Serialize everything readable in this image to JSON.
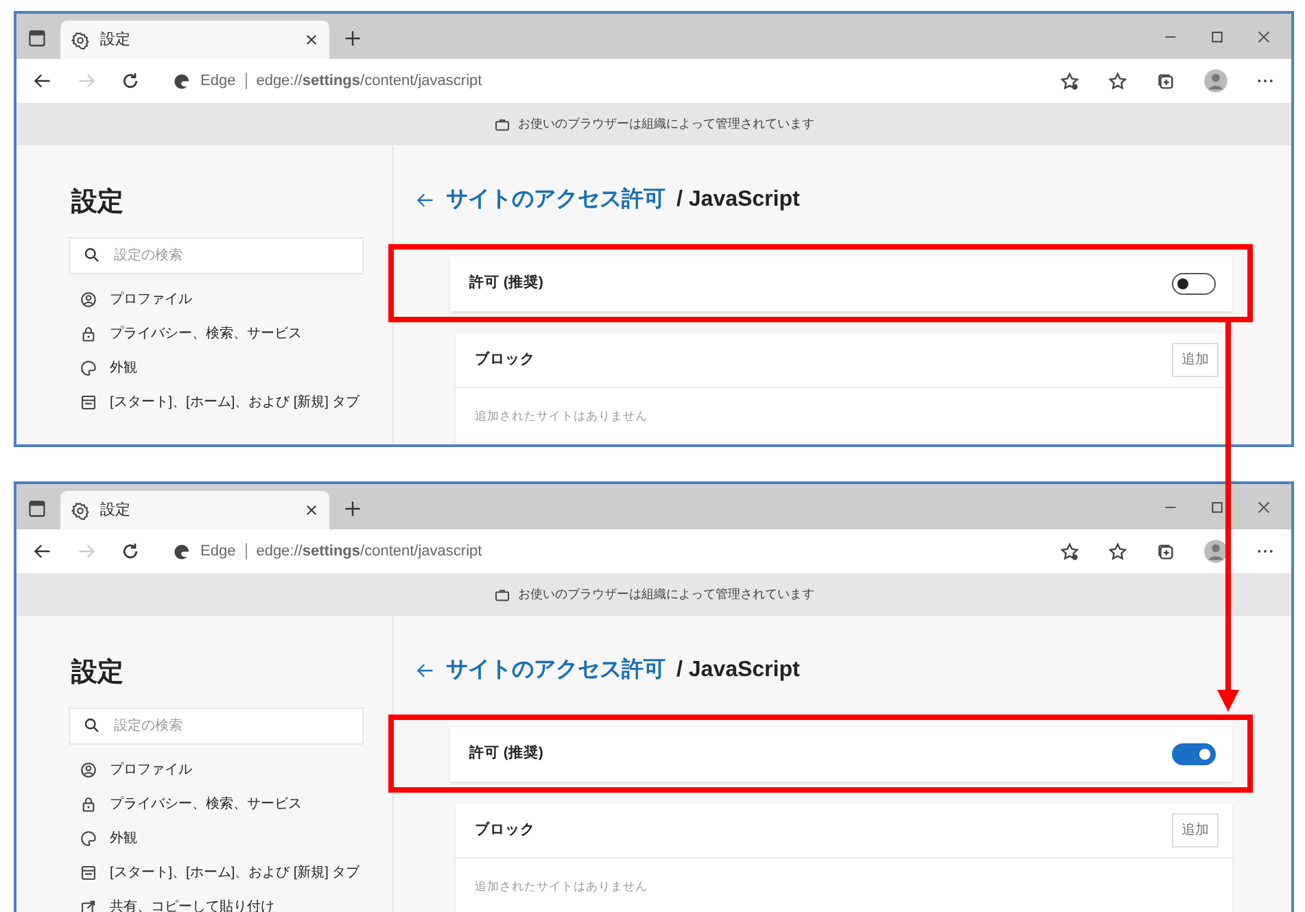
{
  "screenshots": [
    {
      "tab": {
        "title": "設定"
      },
      "address": {
        "site": "Edge",
        "url": "edge://**settings**/content/javascript"
      },
      "infobar": {
        "text": "お使いのブラウザーは組織によって管理されています"
      },
      "sidebar": {
        "title": "設定",
        "search": {
          "placeholder": "設定の検索"
        },
        "items": [
          "プロファイル",
          "プライバシー、検索、サービス",
          "外観",
          "[スタート]、[ホーム]、および [新規] タブ"
        ]
      },
      "breadcrumb": {
        "link": "サイトのアクセス許可",
        "current": "/ JavaScript"
      },
      "allow": {
        "label": "許可 (推奨)",
        "on": false,
        "highlighted": true
      },
      "block": {
        "title": "ブロック",
        "button": "追加",
        "empty": "追加されたサイトはありません"
      }
    },
    {
      "tab": {
        "title": "設定"
      },
      "address": {
        "site": "Edge",
        "url": "edge://**settings**/content/javascript"
      },
      "infobar": {
        "text": "お使いのブラウザーは組織によって管理されています"
      },
      "sidebar": {
        "title": "設定",
        "search": {
          "placeholder": "設定の検索"
        },
        "items": [
          "プロファイル",
          "プライバシー、検索、サービス",
          "外観",
          "[スタート]、[ホーム]、および [新規] タブ",
          "共有、コピーして貼り付け"
        ]
      },
      "breadcrumb": {
        "link": "サイトのアクセス許可",
        "current": "/ JavaScript"
      },
      "allow": {
        "label": "許可 (推奨)",
        "on": true,
        "highlighted": true
      },
      "block": {
        "title": "ブロック",
        "button": "追加",
        "empty": "追加されたサイトはありません"
      }
    }
  ]
}
